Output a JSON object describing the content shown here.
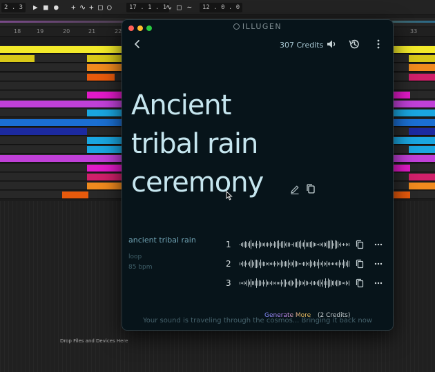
{
  "daw": {
    "transport": {
      "tempo_field": "2 . 3",
      "position_field": "17 . 1 . 1",
      "loop_field": "12 . 0 . 0"
    },
    "ruler_ticks": [
      "18",
      "19",
      "20",
      "21",
      "22",
      "33"
    ],
    "drop_hint": "Drop Files and Devices Here",
    "clip_colors": {
      "yellow": "#f3ea2a",
      "gold": "#d8c818",
      "orange": "#f08a1e",
      "dark_orange": "#e85a0c",
      "magenta": "#e21ac8",
      "violet": "#c040d8",
      "sky": "#1aa6e0",
      "blue": "#1b6fd2",
      "navy": "#1c2aa0",
      "pink": "#d0206a"
    }
  },
  "plugin": {
    "brand": "ILLUGEN",
    "credits": "307 Credits",
    "title": "Ancient tribal rain ceremony",
    "prompt": "ancient tribal rain",
    "meta": {
      "mode": "loop",
      "bpm": "85 bpm"
    },
    "tracks": [
      {
        "number": "1"
      },
      {
        "number": "2"
      },
      {
        "number": "3"
      }
    ],
    "generate_more": "Generate More",
    "generate_cost": "(2 Credits)",
    "status": "Your sound is traveling through the cosmos... Bringing it back now",
    "colors": {
      "background": "#07141a",
      "title": "#c6e6ef",
      "prompt": "#6fa2b3",
      "traffic_red": "#fe5f57",
      "traffic_yellow": "#febc2e",
      "traffic_green": "#28c840"
    }
  }
}
